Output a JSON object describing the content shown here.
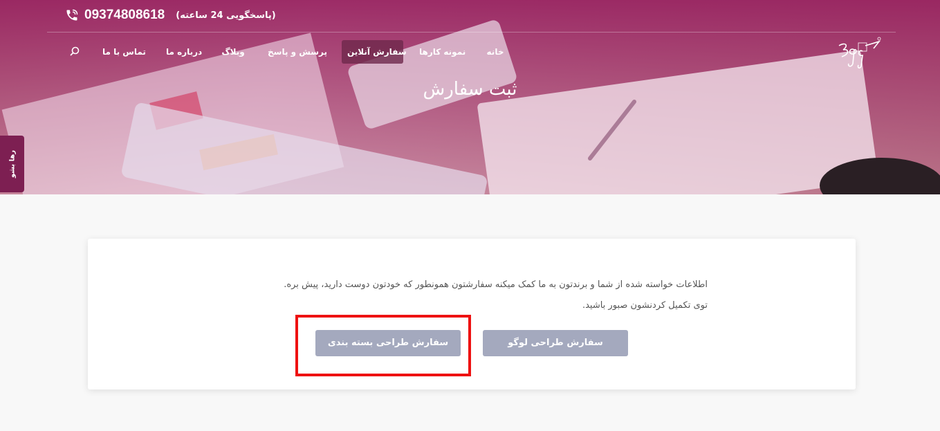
{
  "header": {
    "phone_number": "09374808618",
    "phone_note": "(پاسخگویی 24 ساعته)",
    "phone_icon": "phone-ringing-icon",
    "search_icon": "search-icon"
  },
  "nav": {
    "items": [
      {
        "label": "خانه"
      },
      {
        "label": "نمونه کارها"
      },
      {
        "label": "سفارش آنلاین"
      },
      {
        "label": "پرسش و پاسخ"
      },
      {
        "label": "وبلاگ"
      },
      {
        "label": "درباره ما"
      },
      {
        "label": "تماس با ما"
      }
    ],
    "active_index": 2
  },
  "hero": {
    "title": "ثبت سفارش"
  },
  "side_tab": {
    "label": "رها بشو"
  },
  "card": {
    "line1": "اطلاعات خواسته شده از شما و برندتون به ما کمک میکنه سفارشتون همونطور که خودتون دوست دارید، پیش بره.",
    "line2": "توی تکمیل کردنشون صبور باشید.",
    "logo_button": "سفارش طراحی لوگو",
    "packaging_button": "سفارش طراحی بسته بندی"
  },
  "colors": {
    "brand": "#961e5f",
    "button": "#a4a9be",
    "highlight": "#ee1111"
  }
}
